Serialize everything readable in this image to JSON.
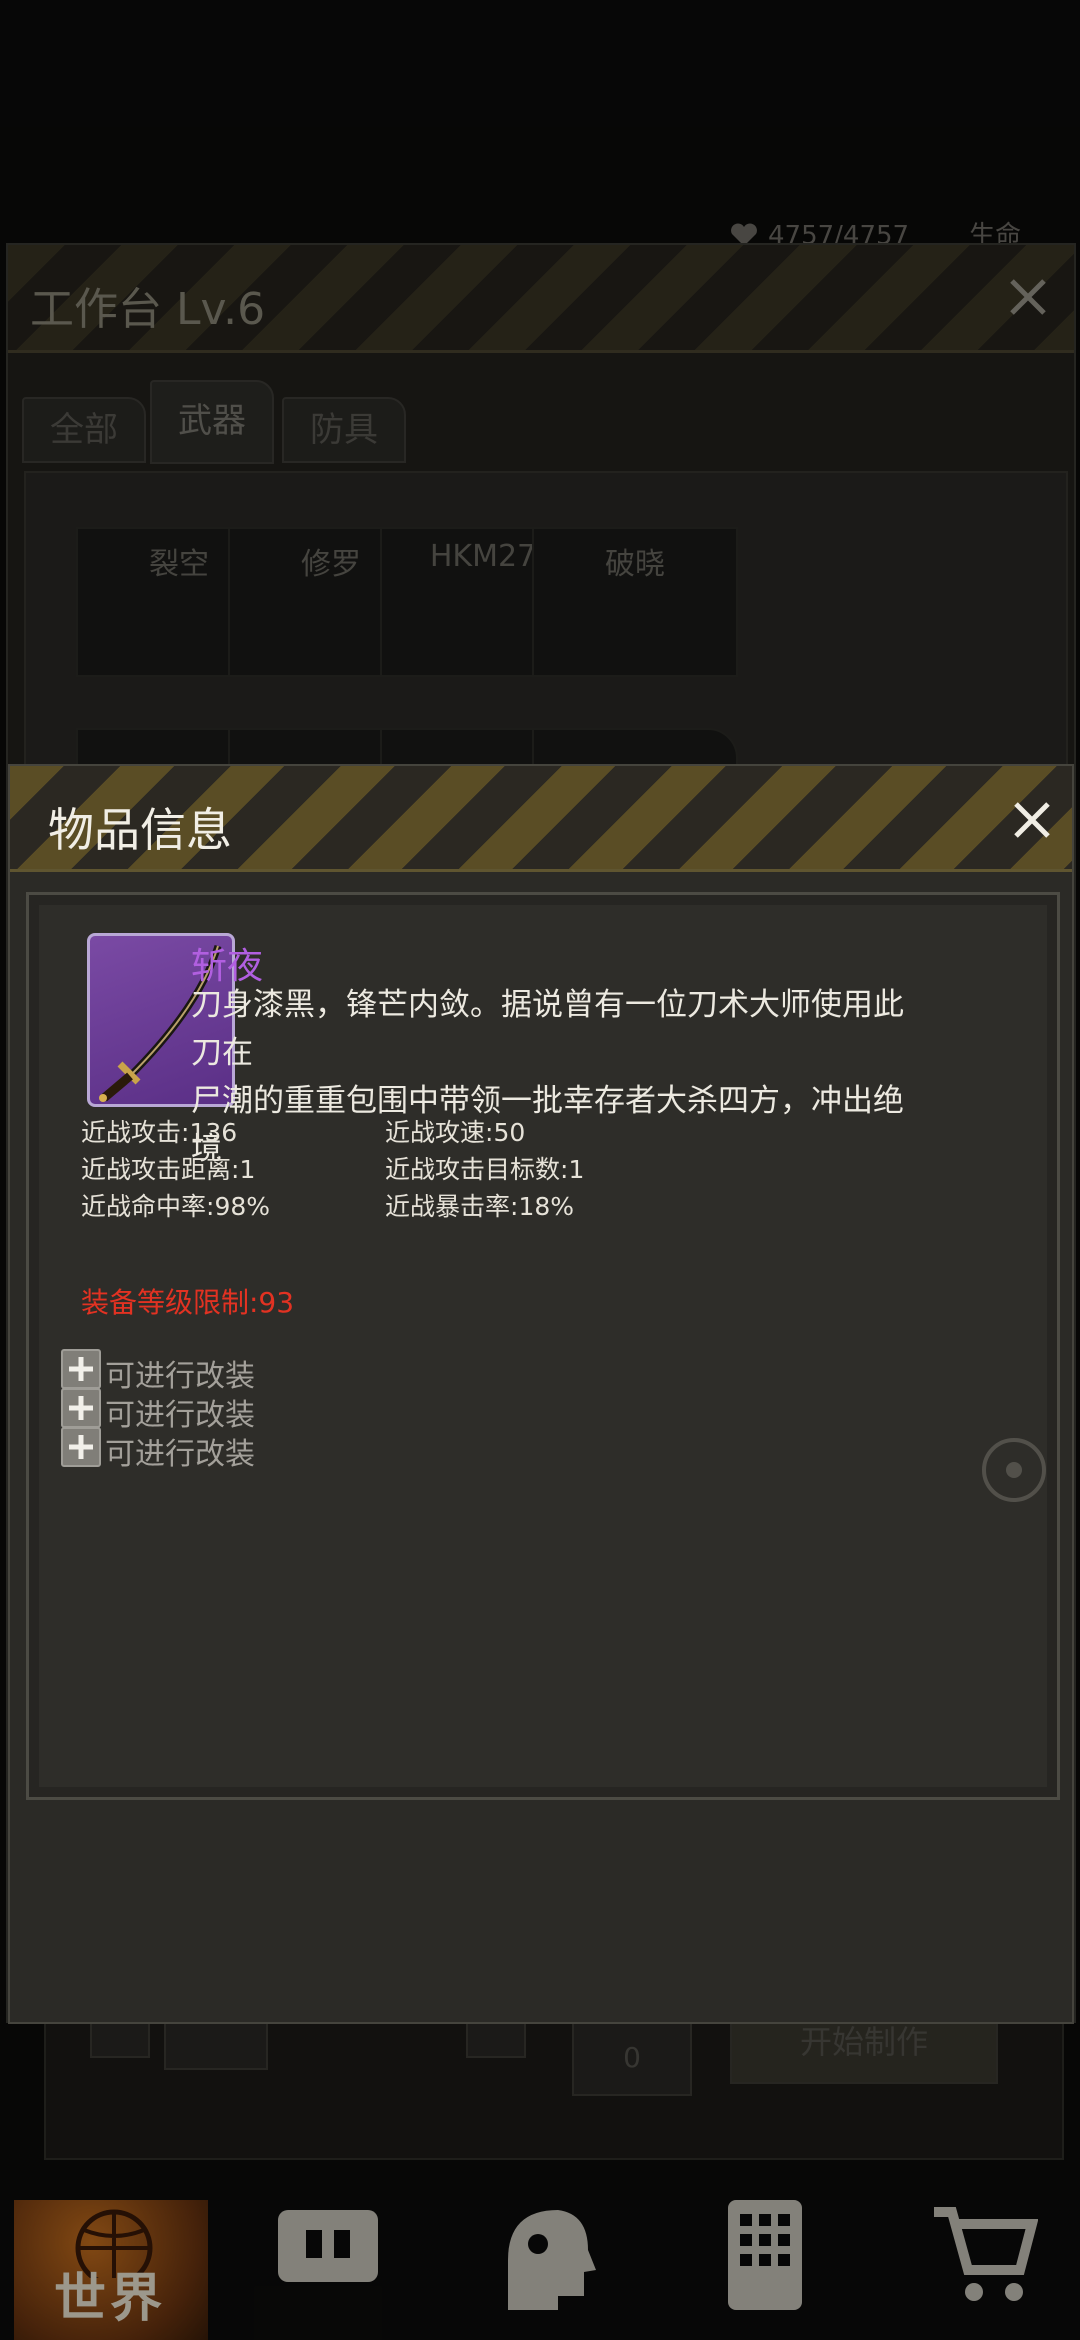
{
  "status": {
    "hp": "4757/4757",
    "hp_label": "生命"
  },
  "workbench": {
    "title": "工作台 Lv.6",
    "tabs": [
      "全部",
      "武器",
      "防具"
    ],
    "slots": [
      "裂空",
      "修罗",
      "HKM27",
      "破晓"
    ],
    "quantity": "0",
    "start_button": "开始制作"
  },
  "nav": {
    "world_label": "世界"
  },
  "item_info": {
    "title": "物品信息",
    "name": "斩夜",
    "description_line1": "刀身漆黑，锋芒内敛。据说曾有一位刀术大师使用此刀在",
    "description_line2": "尸潮的重重包围中带领一批幸存者大杀四方，冲出绝境",
    "stats": [
      {
        "label": "近战攻击",
        "value": "136"
      },
      {
        "label": "近战攻速",
        "value": "50"
      },
      {
        "label": "近战攻击距离",
        "value": "1"
      },
      {
        "label": "近战攻击目标数",
        "value": "1"
      },
      {
        "label": "近战命中率",
        "value": "98%"
      },
      {
        "label": "近战暴击率",
        "value": "18%"
      }
    ],
    "requirement": "装备等级限制:93",
    "mods": [
      "可进行改装",
      "可进行改装",
      "可进行改装"
    ]
  },
  "colors": {
    "item_name": "#b15fe0",
    "requirement": "#e23222",
    "rarity_bg": "#6a3c96"
  }
}
